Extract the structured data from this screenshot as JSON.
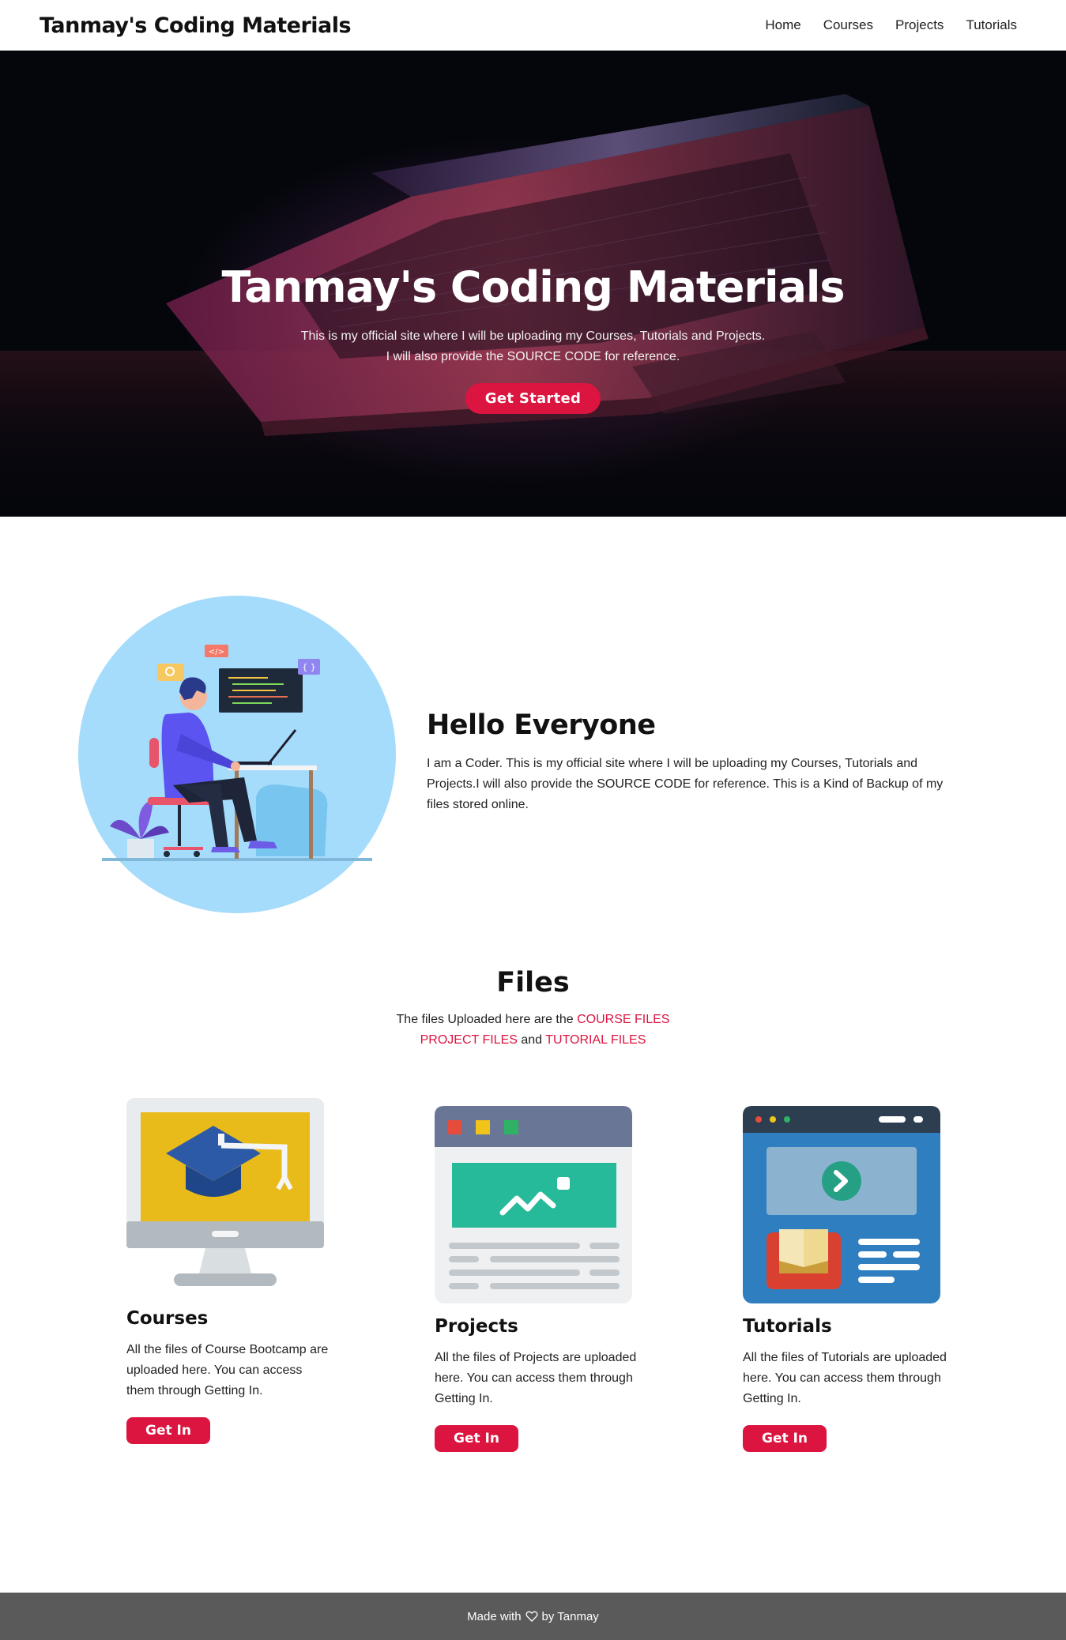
{
  "navbar": {
    "brand": "Tanmay's Coding Materials",
    "links": [
      "Home",
      "Courses",
      "Projects",
      "Tutorials"
    ]
  },
  "hero": {
    "title": "Tanmay's Coding Materials",
    "subtitle_line1": "This is my official site where I will be uploading my Courses, Tutorials and Projects.",
    "subtitle_line2": "I will also provide the SOURCE CODE for reference.",
    "button": "Get Started"
  },
  "about": {
    "title": "Hello Everyone",
    "body": "I am a Coder. This is my official site where I will be uploading my Courses, Tutorials and Projects.I will also provide the SOURCE CODE for reference. This is a Kind of Backup of my files stored online.",
    "illustration_tags": [
      "</>",
      "{ }"
    ]
  },
  "files": {
    "title": "Files",
    "sub_prefix": "The files Uploaded here are the",
    "course_files": "COURSE FILES",
    "project_files": "PROJECT FILES",
    "and": "and",
    "tutorial_files": "TUTORIAL FILES"
  },
  "cards": [
    {
      "title": "Courses",
      "text": "All the files of Course Bootcamp are uploaded here. You can access them through Getting In.",
      "button": "Get In",
      "icon": "graduation-monitor-icon"
    },
    {
      "title": "Projects",
      "text": "All the files of Projects are uploaded here. You can access them through Getting In.",
      "button": "Get In",
      "icon": "browser-window-icon"
    },
    {
      "title": "Tutorials",
      "text": "All the files of Tutorials are uploaded here. You can access them through Getting In.",
      "button": "Get In",
      "icon": "video-tutorial-icon"
    }
  ],
  "footer": {
    "prefix": "Made with",
    "suffix": "by Tanmay"
  },
  "colors": {
    "accent": "#dc1440",
    "footer_bg": "#5a5a5a",
    "hero_bg": "#05060c"
  }
}
